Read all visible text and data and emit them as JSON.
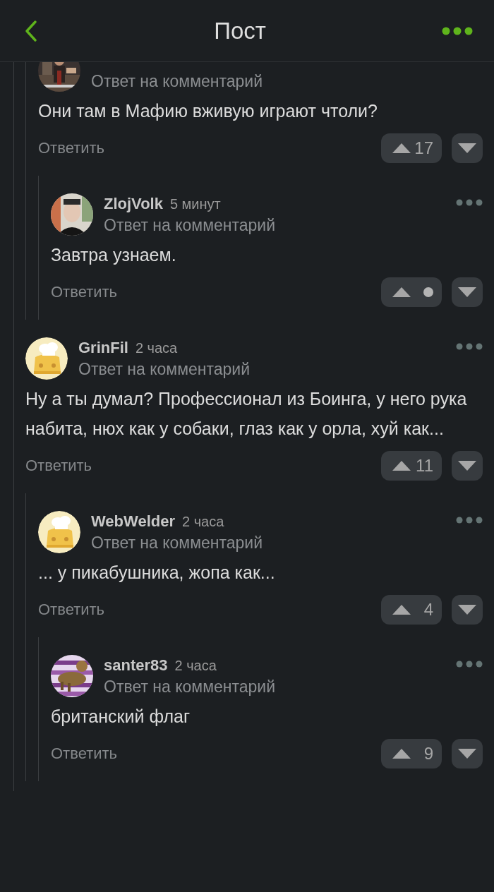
{
  "nav": {
    "title": "Пост"
  },
  "comments": [
    {
      "children": [
        {
          "avatar": {
            "kind": "picture"
          },
          "subtitle": "Ответ на комментарий",
          "text": "Они там в Мафию вживую играют чтоли?",
          "reply": "Ответить",
          "rating": "17",
          "rating_hidden": false,
          "menu": false,
          "children": [
            {
              "author": "ZlojVolk",
              "time": "5 минут",
              "avatar": {
                "kind": "picture"
              },
              "subtitle": "Ответ на комментарий",
              "text": "Завтра узнаем.",
              "reply": "Ответить",
              "rating_hidden": true,
              "menu": true
            }
          ]
        }
      ]
    },
    {
      "author": "GrinFil",
      "time": "2 часа",
      "avatar": {
        "kind": "default"
      },
      "subtitle": "Ответ на комментарий",
      "text": "Ну а ты думал? Профессионал из Боинга, у него рука набита, нюх как у собаки, глаз как у орла, хуй как...",
      "reply": "Ответить",
      "rating": "11",
      "rating_hidden": false,
      "menu": true,
      "children": [
        {
          "author": "WebWelder",
          "time": "2 часа",
          "avatar": {
            "kind": "default"
          },
          "subtitle": "Ответ на комментарий",
          "text": "... у пикабушника, жопа как...",
          "reply": "Ответить",
          "rating": "4",
          "rating_hidden": false,
          "menu": true,
          "children": [
            {
              "author": "santer83",
              "time": "2 часа",
              "avatar": {
                "kind": "picture"
              },
              "subtitle": "Ответ на комментарий",
              "text": "британский флаг",
              "reply": "Ответить",
              "rating": "9",
              "rating_hidden": false,
              "menu": true
            }
          ]
        }
      ]
    }
  ]
}
